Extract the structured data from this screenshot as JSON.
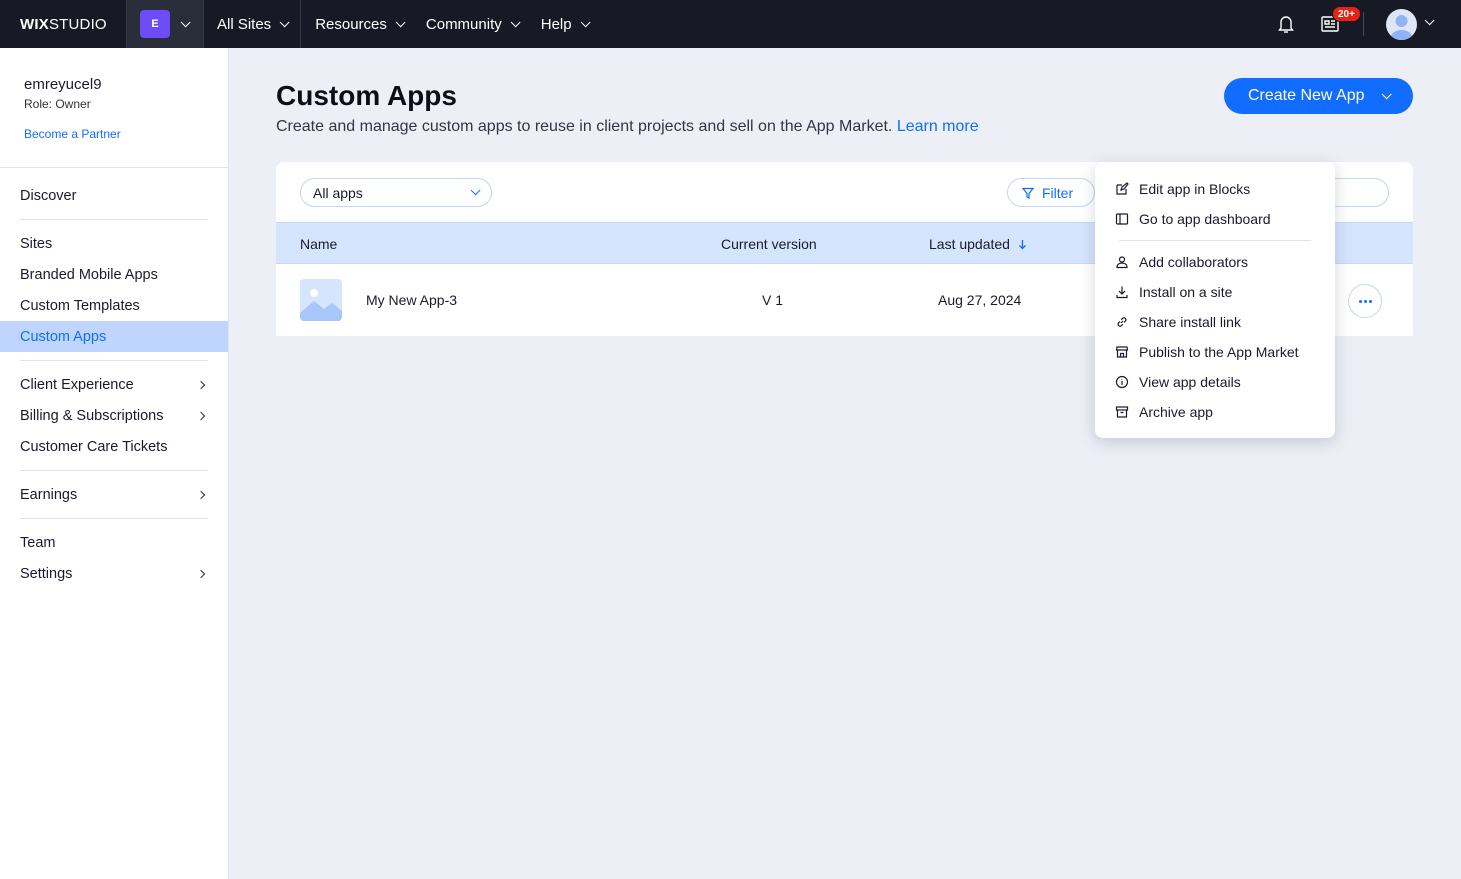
{
  "brand": {
    "logo_bold": "WIX",
    "logo_light": "STUDIO",
    "workspace_initial": "E",
    "accent": "#116dff"
  },
  "topnav": {
    "items": [
      {
        "label": "All Sites"
      },
      {
        "label": "Resources"
      },
      {
        "label": "Community"
      },
      {
        "label": "Help"
      }
    ],
    "notifications_badge": "20+"
  },
  "sidebar": {
    "username": "emreyucel9",
    "role": "Role: Owner",
    "partner_link": "Become a Partner",
    "groups": [
      [
        {
          "label": "Discover",
          "chevron": false
        }
      ],
      [
        {
          "label": "Sites",
          "chevron": false
        },
        {
          "label": "Branded Mobile Apps",
          "chevron": false
        },
        {
          "label": "Custom Templates",
          "chevron": false
        },
        {
          "label": "Custom Apps",
          "chevron": false,
          "active": true
        }
      ],
      [
        {
          "label": "Client Experience",
          "chevron": true
        },
        {
          "label": "Billing & Subscriptions",
          "chevron": true
        },
        {
          "label": "Customer Care Tickets",
          "chevron": false
        }
      ],
      [
        {
          "label": "Earnings",
          "chevron": true
        }
      ],
      [
        {
          "label": "Team",
          "chevron": false
        },
        {
          "label": "Settings",
          "chevron": true
        }
      ]
    ]
  },
  "main": {
    "title": "Custom Apps",
    "subtitle": "Create and manage custom apps to reuse in client projects and sell on the App Market.",
    "learn_more": "Learn more",
    "create_button": "Create New App",
    "filter_select": "All apps",
    "filter_button": "Filter",
    "table": {
      "headers": {
        "name": "Name",
        "version": "Current version",
        "updated": "Last updated"
      },
      "rows": [
        {
          "name": "My New App-3",
          "version": "V 1",
          "updated": "Aug 27, 2024"
        }
      ]
    }
  },
  "menu": {
    "items": [
      {
        "label": "Edit app in Blocks",
        "icon": "edit-icon"
      },
      {
        "label": "Go to app dashboard",
        "icon": "dashboard-icon"
      },
      {
        "label": "Add collaborators",
        "icon": "collaborators-icon"
      },
      {
        "label": "Install on a site",
        "icon": "download-icon"
      },
      {
        "label": "Share install link",
        "icon": "link-icon"
      },
      {
        "label": "Publish to the App Market",
        "icon": "store-icon"
      },
      {
        "label": "View app details",
        "icon": "info-icon"
      },
      {
        "label": "Archive app",
        "icon": "archive-icon"
      }
    ]
  }
}
